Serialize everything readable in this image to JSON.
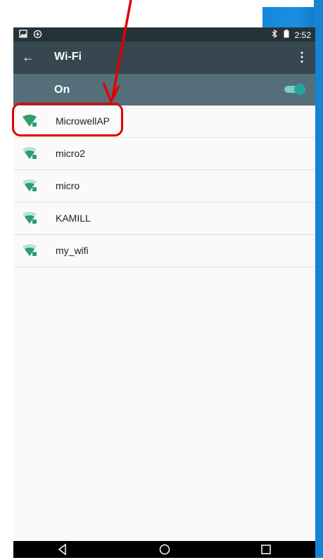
{
  "status_bar": {
    "time": "2:52"
  },
  "toolbar": {
    "back_icon": "arrow-left-icon",
    "title": "Wi-Fi",
    "menu_icon": "more-vertical-icon"
  },
  "wifi_toggle": {
    "label": "On",
    "enabled": true
  },
  "networks": [
    {
      "ssid": "MicrowellAP",
      "signal": "full",
      "secured": true
    },
    {
      "ssid": "micro2",
      "signal": "medium",
      "secured": true
    },
    {
      "ssid": "micro",
      "signal": "medium",
      "secured": true
    },
    {
      "ssid": "KAMILL",
      "signal": "medium",
      "secured": true
    },
    {
      "ssid": "my_wifi",
      "signal": "medium",
      "secured": true
    }
  ],
  "annotation": {
    "highlighted_network": "MicrowellAP",
    "color": "#e00000"
  },
  "colors": {
    "status_bar": "#263238",
    "toolbar": "#37474f",
    "toggle_bar": "#546e7a",
    "wifi_green": "#2e9e6c",
    "accent": "#26a69a"
  }
}
